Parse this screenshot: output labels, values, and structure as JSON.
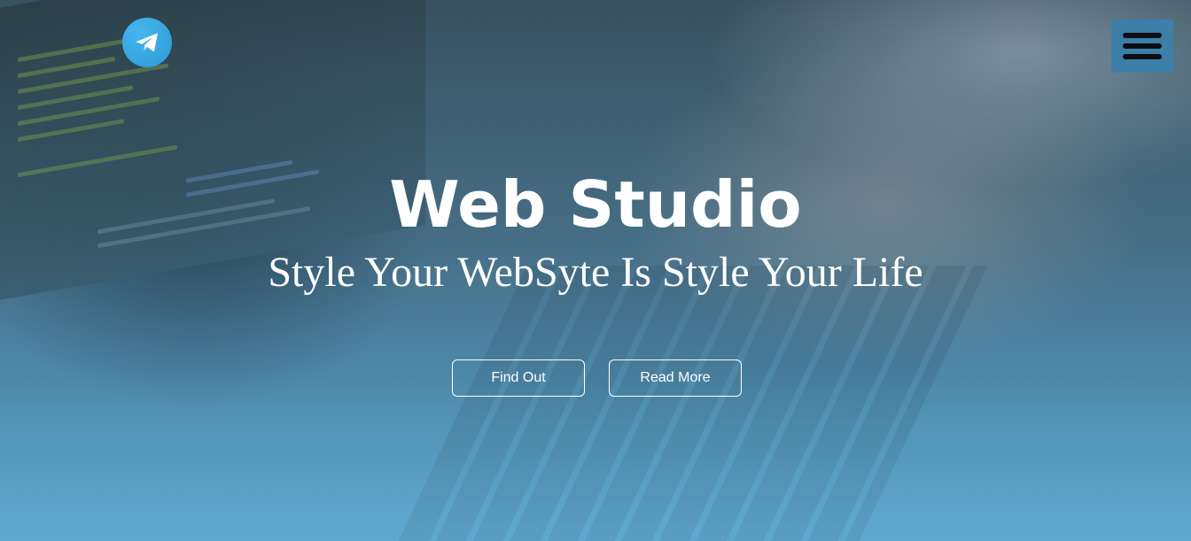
{
  "hero": {
    "title": "Web Studio",
    "subtitle": "Style Your WebSyte Is Style Your Life",
    "buttons": {
      "find_out": "Find Out",
      "read_more": "Read More"
    }
  },
  "icons": {
    "telegram": "telegram-icon",
    "menu": "hamburger-menu-icon"
  },
  "colors": {
    "menu_button_bg": "#3d7fa8",
    "telegram_blue": "#2b9ad6",
    "text": "#ffffff"
  }
}
